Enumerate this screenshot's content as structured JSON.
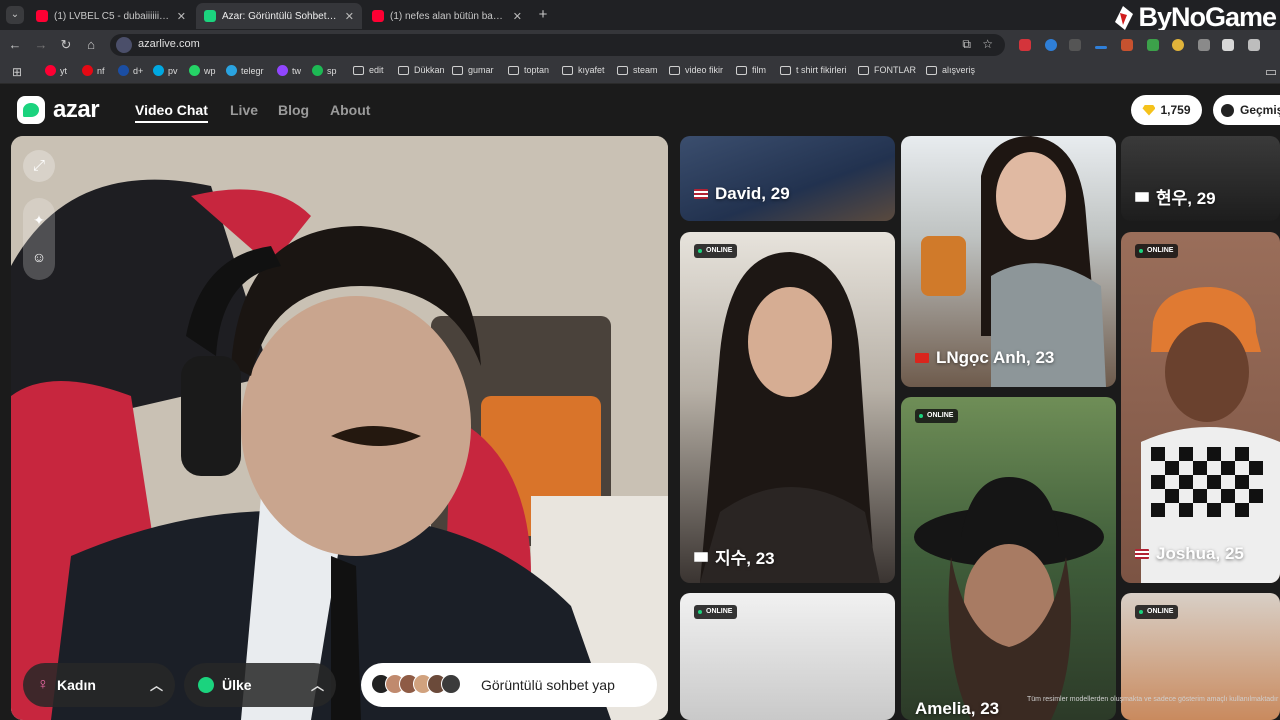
{
  "browser": {
    "tabs": [
      {
        "title": "(1) LVBEL C5 - dubaiiiiii - YouTu",
        "active": false,
        "favicon_color": "#ff0033"
      },
      {
        "title": "Azar: Görüntülü Sohbet, Ar",
        "active": true,
        "favicon_color": "#1bd37e"
      },
      {
        "title": "(1) nefes alan bütün bayan arka",
        "active": false,
        "favicon_color": "#ff0033"
      }
    ],
    "new_tab_label": "+",
    "url": "azarlive.com",
    "watermark": "ByNoGame",
    "bookmarks": [
      {
        "label": "yt",
        "type": "site",
        "color": "#ff0033"
      },
      {
        "label": "nf",
        "type": "site",
        "color": "#e50914"
      },
      {
        "label": "d+",
        "type": "site",
        "color": "#1b4ea3"
      },
      {
        "label": "pv",
        "type": "site",
        "color": "#00a8e1"
      },
      {
        "label": "wp",
        "type": "site",
        "color": "#25d366"
      },
      {
        "label": "telegr",
        "type": "site",
        "color": "#2aa3e0"
      },
      {
        "label": "tw",
        "type": "site",
        "color": "#9146ff"
      },
      {
        "label": "sp",
        "type": "site",
        "color": "#1db954"
      },
      {
        "label": "edit",
        "type": "folder"
      },
      {
        "label": "Dükkan",
        "type": "folder"
      },
      {
        "label": "gumar",
        "type": "folder"
      },
      {
        "label": "toptan",
        "type": "folder"
      },
      {
        "label": "kıyafet",
        "type": "folder"
      },
      {
        "label": "steam",
        "type": "folder"
      },
      {
        "label": "video fikir",
        "type": "folder"
      },
      {
        "label": "film",
        "type": "folder"
      },
      {
        "label": "t shirt fikirleri",
        "type": "folder"
      },
      {
        "label": "FONTLAR",
        "type": "folder"
      },
      {
        "label": "alışveriş",
        "type": "folder"
      }
    ]
  },
  "app": {
    "logo": "azar",
    "nav": {
      "video_chat": "Video Chat",
      "live": "Live",
      "blog": "Blog",
      "about": "About"
    },
    "gems": "1,759",
    "history_label": "Geçmiş",
    "accent_color": "#1bd37e"
  },
  "controls": {
    "gender_label": "Kadın",
    "country_label": "Ülke",
    "start_label": "Görüntülü sohbet yap"
  },
  "online_label": "ONLINE",
  "profiles": {
    "david": "David, 29",
    "hyunwoo": "현우, 29",
    "lngoc": "LNgọc Anh, 23",
    "jisu": "지수, 23",
    "joshua": "Joshua, 25",
    "amelia": "Amelia, 23"
  },
  "disclaimer": "Tüm resimler modellerden oluşmakta ve sadece gösterim amaçlı kullanılmaktadır"
}
